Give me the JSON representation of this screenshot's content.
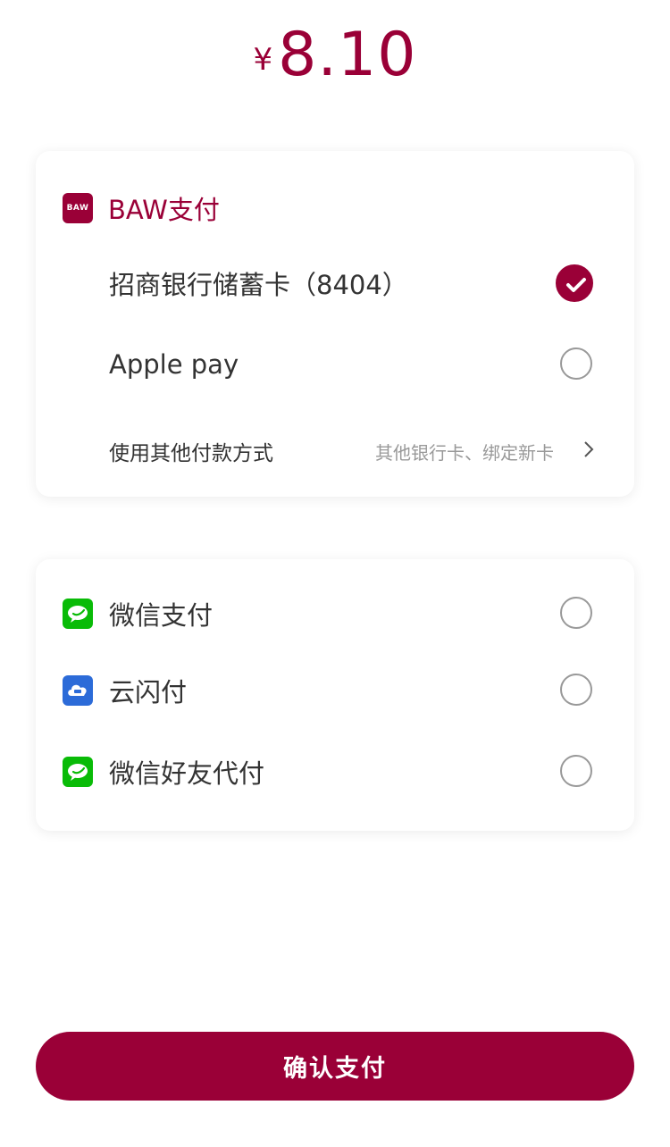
{
  "amount": {
    "currency": "¥",
    "value": "8.10"
  },
  "baw": {
    "logo_text": "BAW",
    "title": "BAW支付",
    "options": [
      {
        "label": "招商银行储蓄卡（8404）",
        "selected": true
      },
      {
        "label": "Apple pay",
        "selected": false
      }
    ],
    "other": {
      "label": "使用其他付款方式",
      "hint": "其他银行卡、绑定新卡"
    }
  },
  "thirdparty": {
    "options": [
      {
        "label": "微信支付",
        "icon": "wechat-icon",
        "selected": false
      },
      {
        "label": "云闪付",
        "icon": "unionpay-cloud-icon",
        "selected": false
      },
      {
        "label": "微信好友代付",
        "icon": "wechat-icon",
        "selected": false
      }
    ]
  },
  "confirm_label": "确认支付",
  "colors": {
    "accent": "#9a0037",
    "wechat": "#09bb07",
    "yunshanfu": "#2c6bd8"
  }
}
